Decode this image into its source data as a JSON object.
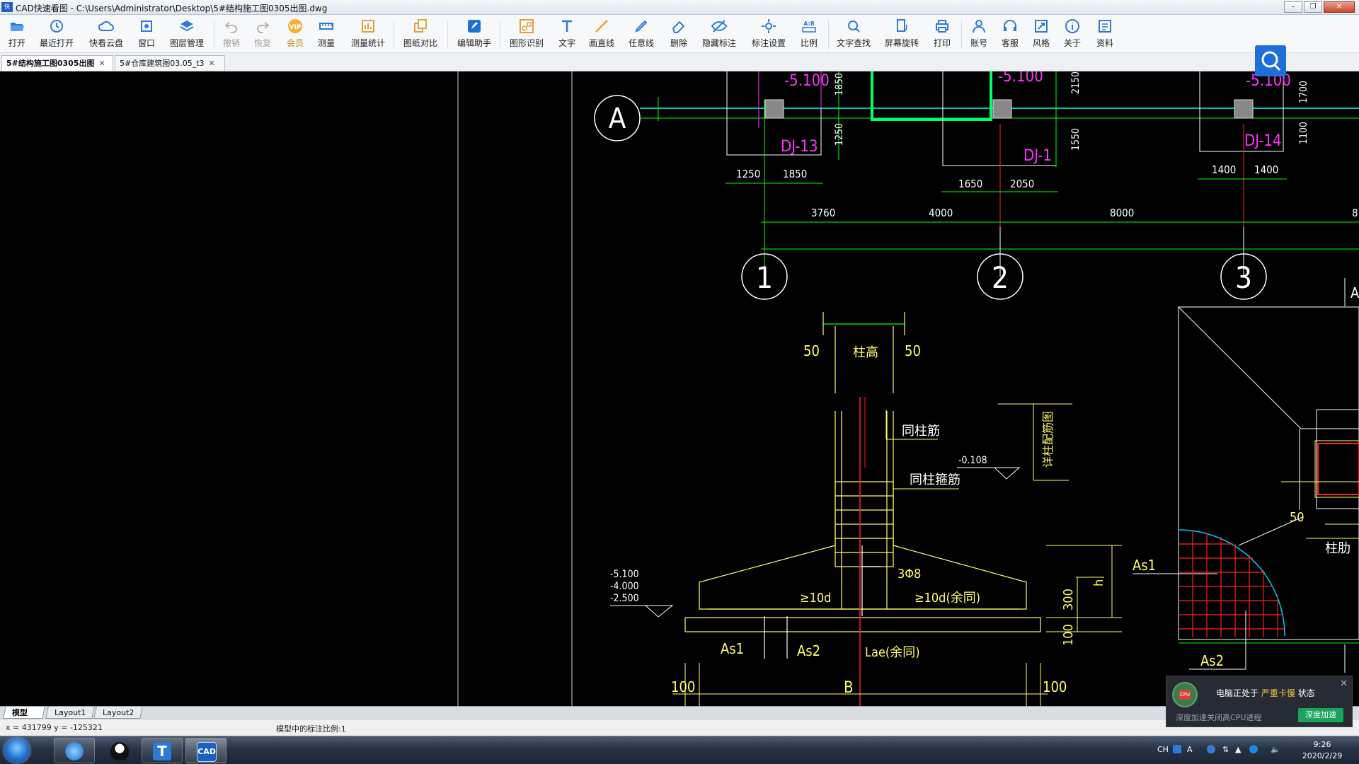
{
  "window": {
    "app_icon": "快",
    "title": "CAD快速看图 - C:\\Users\\Administrator\\Desktop\\5#结构施工图0305出图.dwg",
    "buttons": [
      "minimize-icon",
      "restore-icon",
      "close-icon"
    ]
  },
  "toolbar": {
    "items": [
      {
        "label": "打开",
        "icon": "folder-open-icon"
      },
      {
        "label": "最近打开",
        "icon": "history-icon"
      },
      {
        "label": "快看云盘",
        "icon": "cloud-icon"
      },
      {
        "label": "窗口",
        "icon": "window-icon"
      },
      {
        "label": "图层管理",
        "icon": "layers-icon"
      },
      {
        "label": "撤销",
        "icon": "undo-icon"
      },
      {
        "label": "恢复",
        "icon": "redo-icon"
      },
      {
        "label": "会员",
        "icon": "vip-icon"
      },
      {
        "label": "测量",
        "icon": "ruler-icon"
      },
      {
        "label": "测量统计",
        "icon": "measure-stats-icon"
      },
      {
        "label": "图纸对比",
        "icon": "compare-icon"
      },
      {
        "label": "编辑助手",
        "icon": "edit-assistant-icon"
      },
      {
        "label": "图形识别",
        "icon": "shape-recognize-icon"
      },
      {
        "label": "文字",
        "icon": "text-icon"
      },
      {
        "label": "画直线",
        "icon": "line-icon"
      },
      {
        "label": "任意线",
        "icon": "freehand-icon"
      },
      {
        "label": "删除",
        "icon": "eraser-icon"
      },
      {
        "label": "隐藏标注",
        "icon": "hide-annotation-icon"
      },
      {
        "label": "标注设置",
        "icon": "annotation-settings-icon"
      },
      {
        "label": "比例",
        "icon": "scale-icon"
      },
      {
        "label": "文字查找",
        "icon": "text-search-icon"
      },
      {
        "label": "屏幕旋转",
        "icon": "rotate-screen-icon"
      },
      {
        "label": "打印",
        "icon": "printer-icon"
      },
      {
        "label": "账号",
        "icon": "user-icon"
      },
      {
        "label": "客服",
        "icon": "headset-icon"
      },
      {
        "label": "风格",
        "icon": "style-icon"
      },
      {
        "label": "关于",
        "icon": "info-icon"
      },
      {
        "label": "资料",
        "icon": "library-icon"
      }
    ],
    "search_icon": "search-icon"
  },
  "doc_tabs": [
    {
      "label": "5#结构施工图0305出图",
      "active": true
    },
    {
      "label": "5#仓库建筑图03.05_t3",
      "active": false
    }
  ],
  "drawing": {
    "axis_row": "A",
    "axis_cols": [
      "1",
      "2",
      "3"
    ],
    "elevations_top": [
      "-5.100",
      "-5.100",
      "-5.100"
    ],
    "footings": [
      "DJ-13",
      "DJ-1",
      "DJ-14"
    ],
    "dims_top_small": [
      "1250",
      "1850",
      "1650",
      "2050",
      "1400",
      "1400"
    ],
    "dims_vert_small": [
      "1850",
      "1250",
      "2150",
      "1550",
      "1700",
      "1100"
    ],
    "dims_axes": [
      "3760",
      "4000",
      "8000",
      "8"
    ],
    "detail_labels": {
      "col_height": "柱高",
      "dim50_left": "50",
      "dim50_right": "50",
      "same_rebar": "同柱筋",
      "same_stirrup": "同柱箍筋",
      "elev_0108": "-0.108",
      "see_col_table": "详柱配筋图",
      "elevs_left": [
        "-5.100",
        "-4.000",
        "-2.500"
      ],
      "stirrups": "3Φ8",
      "ten_d_left": "≥10d",
      "ten_d_right": "≥10d(余同)",
      "As1": "As1",
      "As2": "As2",
      "lae": "Lae(余同)",
      "dim100_left": "100",
      "B": "B",
      "dim100_right": "100",
      "dim300": "300",
      "dim100_v": "100",
      "h": "h",
      "As1_right": "As1",
      "As2_right": "As2",
      "dim50_r": "50",
      "col_right": "柱肋",
      "A_edge": "A"
    }
  },
  "layout_tabs": [
    "模型",
    "Layout1",
    "Layout2"
  ],
  "status": {
    "coords": "x = 431799  y = -125321",
    "scale_text": "模型中的标注比例:1"
  },
  "notification": {
    "icon_text": "CPU",
    "message_prefix": "电脑正处于",
    "message_warn": "严重卡慢",
    "message_suffix": "状态",
    "sub": "深度加速关闭高CPU进程",
    "button": "深度加速"
  },
  "taskbar": {
    "apps": [
      "start-orb-icon",
      "browser-icon",
      "qq-icon",
      "t-app-icon",
      "cad-app-icon"
    ],
    "cad_label": "CAD",
    "t_label": "T",
    "tray_lang": "CH",
    "tray_a": "A",
    "time": "9:26",
    "date": "2020/2/29"
  },
  "colors": {
    "canvas_bg": "#000000",
    "cad_green": "#00ff00",
    "cad_cyan": "#00ffff",
    "cad_magenta": "#ff00ff",
    "cad_yellow": "#ffff66",
    "cad_red": "#ff2020",
    "cad_white": "#ffffff",
    "accent": "#1e6fd9"
  }
}
